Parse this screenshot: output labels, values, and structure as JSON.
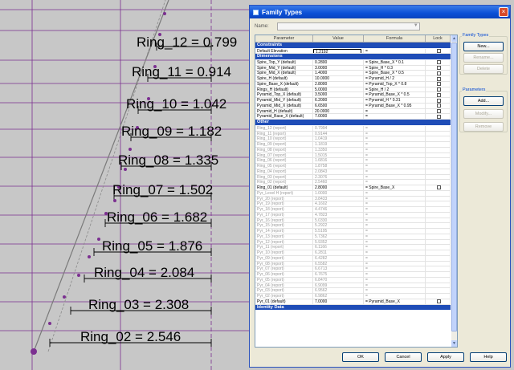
{
  "drawing": {
    "rings": [
      {
        "label": "Ring_12 = 0.799"
      },
      {
        "label": "Ring_11 = 0.914"
      },
      {
        "label": "Ring_10 = 1.042"
      },
      {
        "label": "Ring_09 = 1.182"
      },
      {
        "label": "Ring_08 = 1.335"
      },
      {
        "label": "Ring_07 = 1.502"
      },
      {
        "label": "Ring_06 = 1.682"
      },
      {
        "label": "Ring_05 = 1.876"
      },
      {
        "label": "Ring_04 = 2.084"
      },
      {
        "label": "Ring_03 = 2.308"
      },
      {
        "label": "Ring_02 = 2.546"
      }
    ],
    "colors": {
      "background": "#c7c7c7",
      "reference_line": "#7b2f90",
      "dimension_line": "#000000"
    }
  },
  "dialog": {
    "title": "Family Types",
    "close_glyph": "×",
    "name_label": "Name:",
    "name_value": "",
    "columns": {
      "parameter": "Parameter",
      "value": "Value",
      "formula": "Formula",
      "lock": "Lock"
    },
    "groups": [
      {
        "title": "Constraints",
        "rows": [
          {
            "param": "Default Elevation",
            "value": "1.2192",
            "formula": "=",
            "lock": true,
            "gray": false,
            "editing": true
          }
        ]
      },
      {
        "title": "Dimensions",
        "rows": [
          {
            "param": "Spire_Top_Y (default)",
            "value": "0.2800",
            "formula": "= Spire_Base_X * 0.1",
            "lock": true,
            "gray": false
          },
          {
            "param": "Spire_Mid_Y (default)",
            "value": "3.0000",
            "formula": "= Spire_H * 0.3",
            "lock": true,
            "gray": false
          },
          {
            "param": "Spire_Mid_X (default)",
            "value": "1.4000",
            "formula": "= Spire_Base_X * 0.5",
            "lock": true,
            "gray": false
          },
          {
            "param": "Spire_H (default)",
            "value": "10.0000",
            "formula": "= Pyramid_H / 2",
            "lock": true,
            "gray": false
          },
          {
            "param": "Spire_Base_X (default)",
            "value": "2.8000",
            "formula": "= Pyramid_Top_X * 0.8",
            "lock": true,
            "gray": false
          },
          {
            "param": "Rings_H (default)",
            "value": "5.0000",
            "formula": "= Spire_H / 2",
            "lock": true,
            "gray": false
          },
          {
            "param": "Pyramid_Top_X (default)",
            "value": "3.5000",
            "formula": "= Pyramid_Base_X * 0.5",
            "lock": true,
            "gray": false
          },
          {
            "param": "Pyramid_Mid_Y (default)",
            "value": "6.2000",
            "formula": "= Pyramid_H * 0.31",
            "lock": true,
            "gray": false
          },
          {
            "param": "Pyramid_Mid_X (default)",
            "value": "6.6500",
            "formula": "= Pyramid_Base_X * 0.95",
            "lock": true,
            "gray": false
          },
          {
            "param": "Pyramid_H (default)",
            "value": "20.0000",
            "formula": "=",
            "lock": true,
            "gray": false
          },
          {
            "param": "Pyramid_Base_X (default)",
            "value": "7.0000",
            "formula": "=",
            "lock": true,
            "gray": false
          }
        ]
      },
      {
        "title": "Other",
        "rows": [
          {
            "param": "Ring_12 (report)",
            "value": "0.7994",
            "formula": "=",
            "lock": false,
            "gray": true
          },
          {
            "param": "Ring_11 (report)",
            "value": "0.9144",
            "formula": "=",
            "lock": false,
            "gray": true
          },
          {
            "param": "Ring_10 (report)",
            "value": "1.0419",
            "formula": "=",
            "lock": false,
            "gray": true
          },
          {
            "param": "Ring_09 (report)",
            "value": "1.1819",
            "formula": "=",
            "lock": false,
            "gray": true
          },
          {
            "param": "Ring_08 (report)",
            "value": "1.3350",
            "formula": "=",
            "lock": false,
            "gray": true
          },
          {
            "param": "Ring_07 (report)",
            "value": "1.5015",
            "formula": "=",
            "lock": false,
            "gray": true
          },
          {
            "param": "Ring_06 (report)",
            "value": "1.6816",
            "formula": "=",
            "lock": false,
            "gray": true
          },
          {
            "param": "Ring_05 (report)",
            "value": "1.8758",
            "formula": "=",
            "lock": false,
            "gray": true
          },
          {
            "param": "Ring_04 (report)",
            "value": "2.0843",
            "formula": "=",
            "lock": false,
            "gray": true
          },
          {
            "param": "Ring_03 (report)",
            "value": "2.3076",
            "formula": "=",
            "lock": false,
            "gray": true
          },
          {
            "param": "Ring_02 (report)",
            "value": "2.5460",
            "formula": "=",
            "lock": false,
            "gray": true
          },
          {
            "param": "Ring_01 (default)",
            "value": "2.8000",
            "formula": "= Spire_Base_X",
            "lock": true,
            "gray": false
          },
          {
            "param": "Pyr_Level H (report)",
            "value": "1.0000",
            "formula": "=",
            "lock": false,
            "gray": true
          },
          {
            "param": "Pyr_20 (report)",
            "value": "3.8433",
            "formula": "=",
            "lock": false,
            "gray": true
          },
          {
            "param": "Pyr_19 (report)",
            "value": "4.1602",
            "formula": "=",
            "lock": false,
            "gray": true
          },
          {
            "param": "Pyr_18 (report)",
            "value": "4.4746",
            "formula": "=",
            "lock": false,
            "gray": true
          },
          {
            "param": "Pyr_17 (report)",
            "value": "4.7823",
            "formula": "=",
            "lock": false,
            "gray": true
          },
          {
            "param": "Pyr_16 (report)",
            "value": "5.0330",
            "formula": "=",
            "lock": false,
            "gray": true
          },
          {
            "param": "Pyr_15 (report)",
            "value": "5.2922",
            "formula": "=",
            "lock": false,
            "gray": true
          },
          {
            "param": "Pyr_14 (report)",
            "value": "5.5195",
            "formula": "=",
            "lock": false,
            "gray": true
          },
          {
            "param": "Pyr_13 (report)",
            "value": "5.7362",
            "formula": "=",
            "lock": false,
            "gray": true
          },
          {
            "param": "Pyr_12 (report)",
            "value": "5.9352",
            "formula": "=",
            "lock": false,
            "gray": true
          },
          {
            "param": "Pyr_11 (report)",
            "value": "6.1166",
            "formula": "=",
            "lock": false,
            "gray": true
          },
          {
            "param": "Pyr_10 (report)",
            "value": "6.2811",
            "formula": "=",
            "lock": false,
            "gray": true
          },
          {
            "param": "Pyr_09 (report)",
            "value": "6.4282",
            "formula": "=",
            "lock": false,
            "gray": true
          },
          {
            "param": "Pyr_08 (report)",
            "value": "6.5582",
            "formula": "=",
            "lock": false,
            "gray": true
          },
          {
            "param": "Pyr_07 (report)",
            "value": "6.6713",
            "formula": "=",
            "lock": false,
            "gray": true
          },
          {
            "param": "Pyr_06 (report)",
            "value": "6.7675",
            "formula": "=",
            "lock": false,
            "gray": true
          },
          {
            "param": "Pyr_05 (report)",
            "value": "6.8470",
            "formula": "=",
            "lock": false,
            "gray": true
          },
          {
            "param": "Pyr_04 (report)",
            "value": "6.9099",
            "formula": "=",
            "lock": false,
            "gray": true
          },
          {
            "param": "Pyr_03 (report)",
            "value": "6.9562",
            "formula": "=",
            "lock": false,
            "gray": true
          },
          {
            "param": "Pyr_02 (report)",
            "value": "6.9862",
            "formula": "=",
            "lock": false,
            "gray": true
          },
          {
            "param": "Pyr_01 (default)",
            "value": "7.0000",
            "formula": "= Pyramid_Base_X",
            "lock": true,
            "gray": false
          }
        ]
      },
      {
        "title": "Identity Data",
        "rows": []
      }
    ],
    "family_types": {
      "title": "Family Types",
      "new": "New...",
      "rename": "Rename...",
      "delete": "Delete"
    },
    "parameters": {
      "title": "Parameters",
      "add": "Add...",
      "modify": "Modify...",
      "remove": "Remove"
    },
    "buttons": {
      "ok": "OK",
      "cancel": "Cancel",
      "apply": "Apply",
      "help": "Help"
    },
    "scroll_up_glyph": "▲",
    "scroll_down_glyph": "▼",
    "dropdown_glyph": "▼"
  }
}
